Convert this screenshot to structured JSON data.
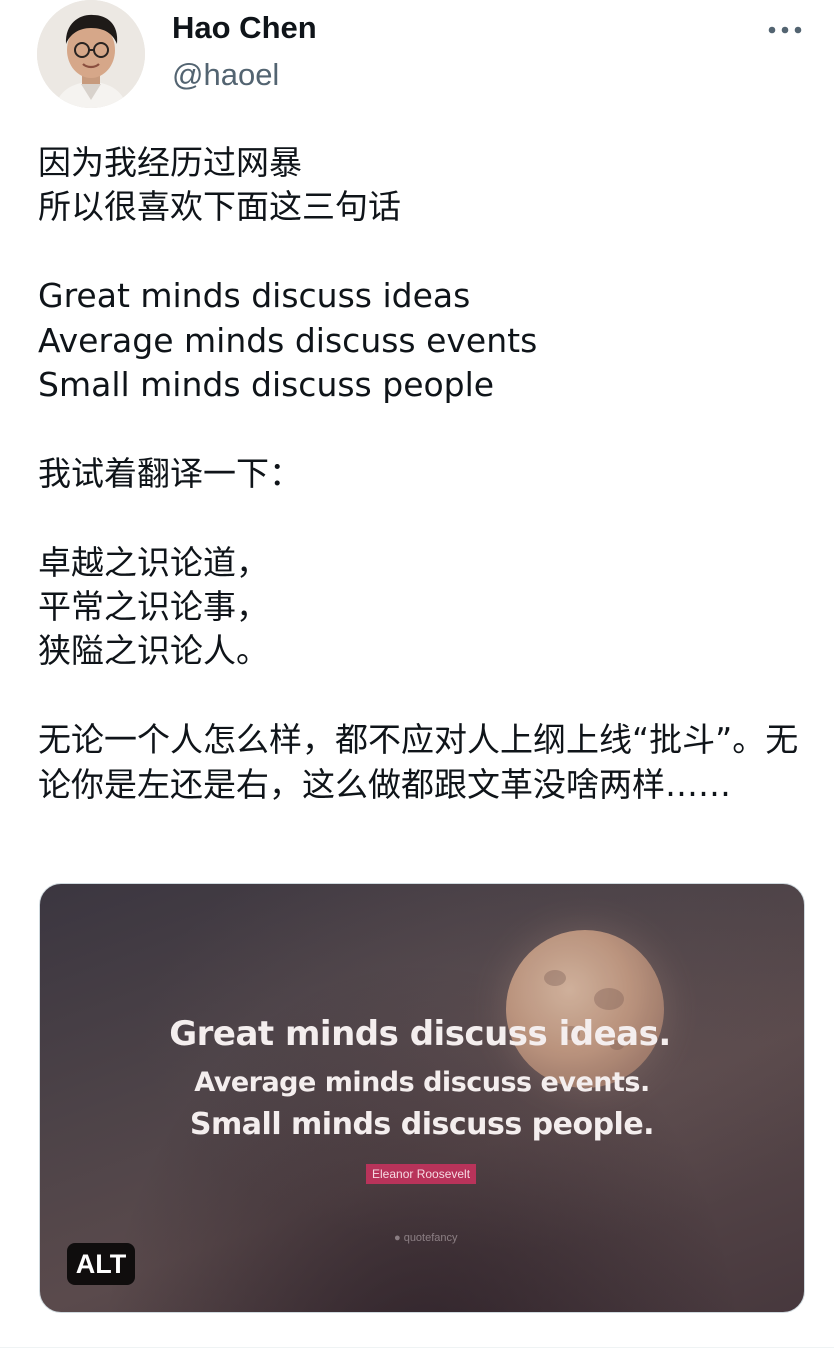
{
  "author": {
    "display_name": "Hao Chen",
    "handle": "@haoel"
  },
  "tweet": {
    "text": "因为我经历过网暴\n所以很喜欢下面这三句话\n\nGreat minds discuss ideas\nAverage minds discuss events\nSmall minds discuss people\n\n我试着翻译一下：\n\n卓越之识论道，\n平常之识论事，\n狭隘之识论人。\n\n无论一个人怎么样，都不应对人上纲上线“批斗”。无论你是左还是右，这么做都跟文革没啥两样……"
  },
  "media": {
    "quote_lines": [
      "Great minds discuss ideas.",
      "Average minds discuss events.",
      "Small minds discuss people."
    ],
    "author_tag": "Eleanor Roosevelt",
    "watermark": "● quotefancy",
    "alt_badge": "ALT"
  },
  "icons": {
    "more": "more-horizontal-icon"
  },
  "colors": {
    "text_primary": "#0f1419",
    "text_secondary": "#536471",
    "author_tag_bg": "#b8335a"
  }
}
